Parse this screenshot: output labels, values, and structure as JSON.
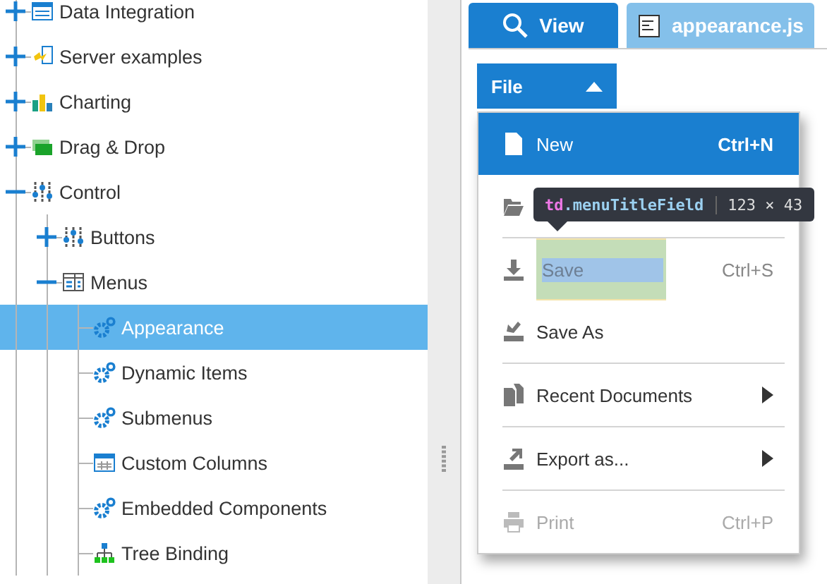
{
  "tree": [
    {
      "label": "Data Integration",
      "kind": "grid",
      "expanded": false,
      "selected": false
    },
    {
      "label": "Server examples",
      "kind": "server",
      "expanded": false,
      "selected": false
    },
    {
      "label": "Charting",
      "kind": "chart",
      "expanded": false,
      "selected": false
    },
    {
      "label": "Drag & Drop",
      "kind": "folders",
      "expanded": false,
      "selected": false
    },
    {
      "label": "Control",
      "kind": "sliders",
      "expanded": true,
      "selected": false,
      "children": [
        {
          "label": "Buttons",
          "kind": "sliders",
          "expanded": false,
          "selected": false
        },
        {
          "label": "Menus",
          "kind": "menu",
          "expanded": true,
          "selected": false,
          "children": [
            {
              "label": "Appearance",
              "kind": "gears",
              "selected": true
            },
            {
              "label": "Dynamic Items",
              "kind": "gears",
              "selected": false
            },
            {
              "label": "Submenus",
              "kind": "gears",
              "selected": false
            },
            {
              "label": "Custom Columns",
              "kind": "table",
              "selected": false
            },
            {
              "label": "Embedded Components",
              "kind": "gears",
              "selected": false
            },
            {
              "label": "Tree Binding",
              "kind": "tree",
              "selected": false
            }
          ]
        }
      ]
    }
  ],
  "tabs": [
    {
      "label": "View",
      "kind": "search",
      "selected": true
    },
    {
      "label": "appearance.js",
      "kind": "file",
      "selected": false
    }
  ],
  "file_button": {
    "label": "File",
    "open": true
  },
  "menu": [
    {
      "kind": "item",
      "label": "New",
      "shortcut": "Ctrl+N",
      "highlighted": true,
      "disabled": false,
      "separator_before": false,
      "inspected": false
    },
    {
      "kind": "item",
      "highlighted": false,
      "disabled": false,
      "separator_before": false,
      "inspected": false
    },
    {
      "kind": "item",
      "label": "Save",
      "shortcut": "Ctrl+S",
      "highlighted": false,
      "disabled": false,
      "separator_before": true,
      "inspected": true
    },
    {
      "kind": "item",
      "label": "Save As",
      "highlighted": false,
      "disabled": false,
      "separator_before": false,
      "inspected": false
    },
    {
      "kind": "submenu",
      "label": "Recent Documents",
      "highlighted": false,
      "disabled": false,
      "separator_before": true,
      "inspected": false
    },
    {
      "kind": "submenu",
      "label": "Export as...",
      "highlighted": false,
      "disabled": false,
      "separator_before": true,
      "inspected": false
    },
    {
      "kind": "item",
      "label": "Print",
      "shortcut": "Ctrl+P",
      "highlighted": false,
      "disabled": true,
      "separator_before": true,
      "inspected": false
    }
  ],
  "inspect_tooltip": {
    "element": "td",
    "class_name": ".menuTitleField",
    "size": "123 × 43"
  }
}
